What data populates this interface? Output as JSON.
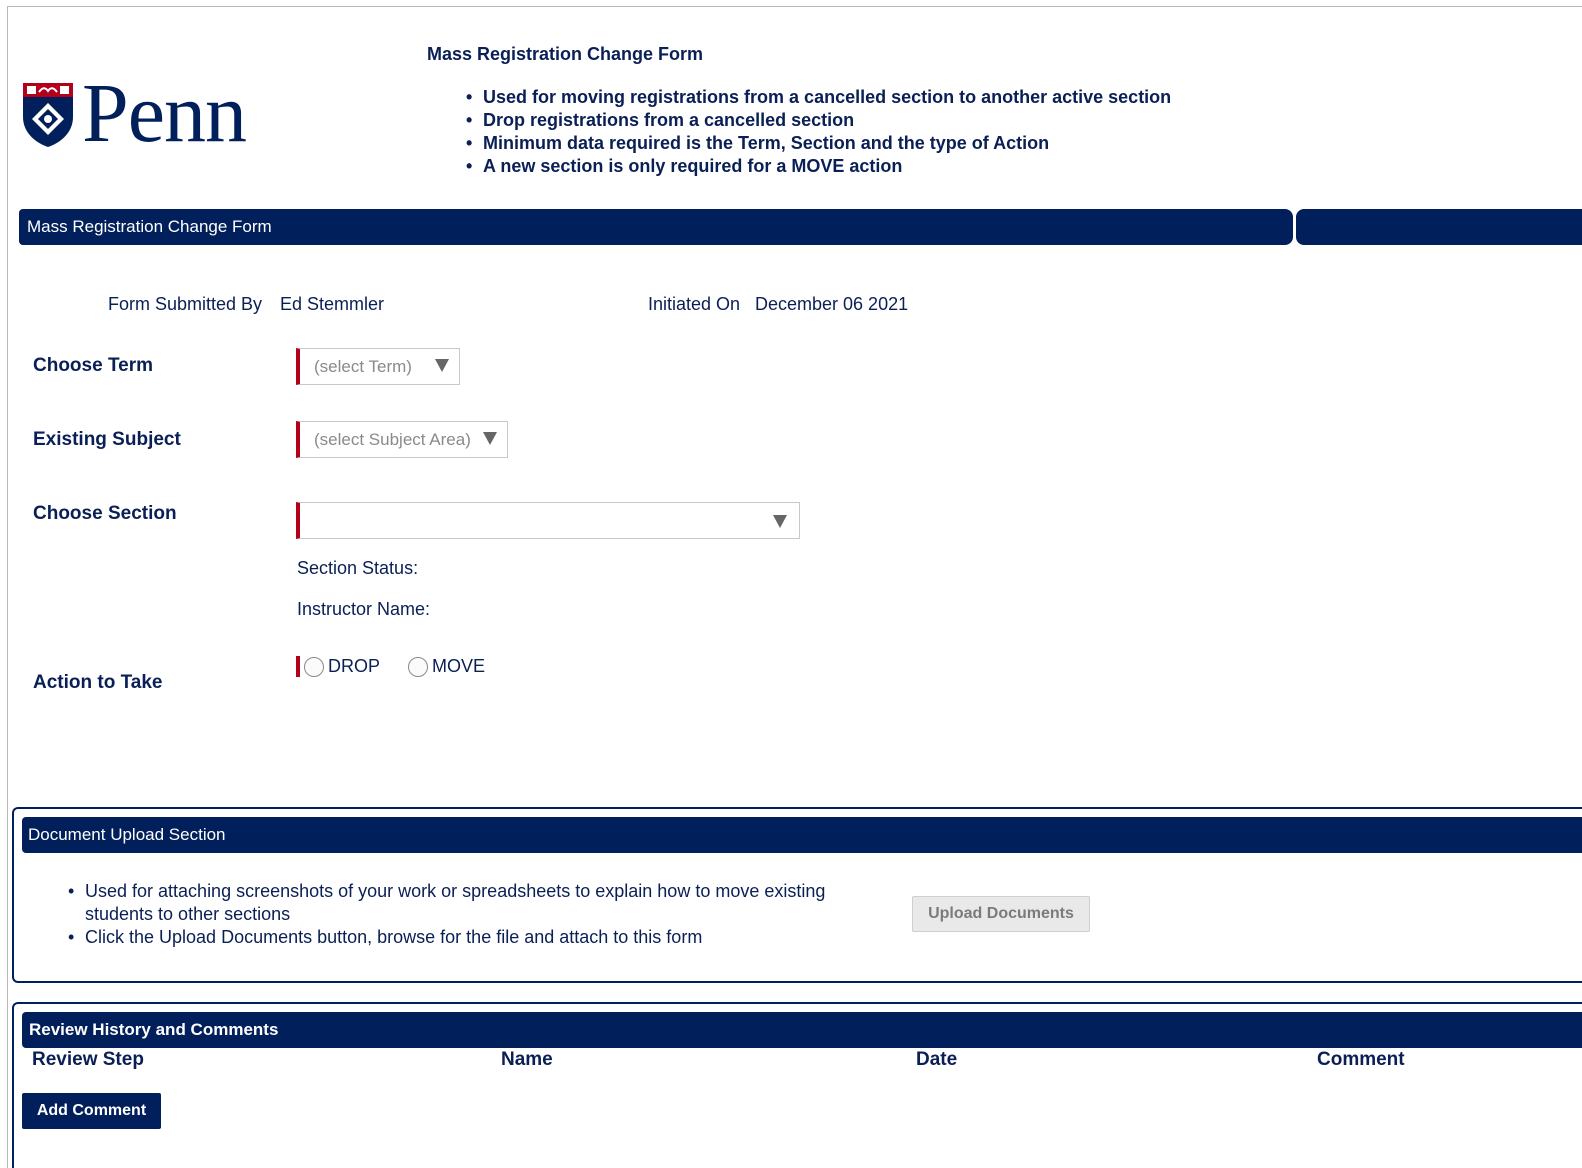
{
  "header": {
    "logo_text": "Penn",
    "title": "Mass Registration Change Form",
    "bullets": [
      "Used for moving registrations from a cancelled section to another active section",
      "Drop registrations from a cancelled section",
      "Minimum data required is the Term, Section and the type of Action",
      "A new section is only required for a MOVE action"
    ]
  },
  "form": {
    "bar_title": "Mass Registration Change Form",
    "submitted_by_label": "Form Submitted By",
    "submitted_by_value": "Ed Stemmler",
    "initiated_on_label": "Initiated On",
    "initiated_on_value": "December 06 2021",
    "term": {
      "label": "Choose Term",
      "selected": "(select Term)"
    },
    "subject": {
      "label": "Existing Subject",
      "selected": "(select Subject Area)"
    },
    "section": {
      "label": "Choose Section",
      "selected": ""
    },
    "section_status_label": "Section Status:",
    "instructor_name_label": "Instructor Name:",
    "action": {
      "label": "Action to Take",
      "options": [
        "DROP",
        "MOVE"
      ]
    }
  },
  "upload": {
    "bar_title": "Document Upload Section",
    "bullets": [
      "Used for attaching screenshots of your work or spreadsheets to explain how to move existing students to other sections",
      "Click the Upload Documents button, browse for the file and attach to this form"
    ],
    "button_label": "Upload Documents"
  },
  "review": {
    "bar_title": "Review History and Comments",
    "columns": [
      "Review Step",
      "Name",
      "Date",
      "Comment"
    ],
    "add_comment_label": "Add Comment"
  },
  "colors": {
    "penn_blue": "#011f5b",
    "required_red": "#b3001b",
    "text_navy": "#0a1f55"
  }
}
